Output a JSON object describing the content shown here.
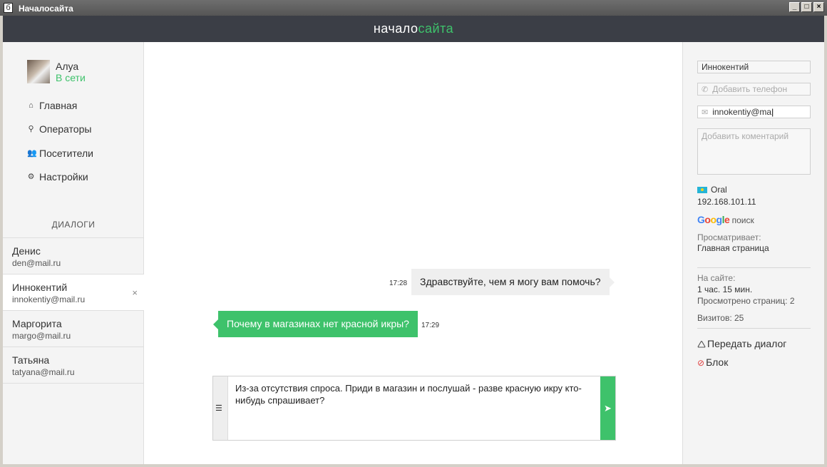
{
  "window": {
    "title": "Началосайта",
    "app_icon": "б",
    "buttons": [
      "_",
      "□",
      "×"
    ]
  },
  "header": {
    "logo_white": "начало",
    "logo_green": "сайта"
  },
  "colors": {
    "accent": "#3ec26b",
    "header_bg": "#3b3e46",
    "sidebar_bg": "#f4f4f4"
  },
  "user": {
    "name": "Алуа",
    "status": "В сети"
  },
  "nav": {
    "items": [
      {
        "label": "Главная",
        "icon": "home-icon"
      },
      {
        "label": "Операторы",
        "icon": "operators-icon"
      },
      {
        "label": "Посетители",
        "icon": "visitors-icon"
      },
      {
        "label": "Настройки",
        "icon": "gear-icon"
      }
    ]
  },
  "dialogs": {
    "title": "ДИАЛОГИ",
    "items": [
      {
        "name": "Денис",
        "email": "den@mail.ru"
      },
      {
        "name": "Иннокентий",
        "email": "innokentiy@mail.ru",
        "active": true,
        "close": "×"
      },
      {
        "name": "Маргорита",
        "email": "margo@mail.ru"
      },
      {
        "name": "Татьяна",
        "email": "tatyana@mail.ru"
      }
    ]
  },
  "chat": {
    "messages": [
      {
        "from": "operator",
        "time": "17:28",
        "text": "Здравствуйте, чем я могу вам помочь?"
      },
      {
        "from": "visitor",
        "time": "17:29",
        "text": "Почему в магазинах нет красной икры?"
      }
    ],
    "composer": {
      "text": "Из-за отсутствия спроса. Приди в магазин и послушай - разве красную икру кто-нибудь спрашивает?",
      "template_icon": "template-list-icon",
      "send_icon": "send-icon"
    }
  },
  "visitor": {
    "name_value": "Иннокентий",
    "phone_placeholder": "Добавить телефон",
    "email_value": "innokentiy@ma",
    "comment_placeholder": "Добавить коментарий",
    "city": "Oral",
    "ip": "192.168.101.11",
    "source_engine": "Google",
    "source_type": "поиск",
    "viewing_label": "Просматривает:",
    "viewing_page": "Главная страница",
    "on_site_label": "На сайте:",
    "on_site_value": "1 час. 15 мин.",
    "pages_viewed": "Просмотрено страниц: 2",
    "visits": "Визитов: 25"
  },
  "actions": {
    "transfer": "Передать диалог",
    "block": "Блок"
  }
}
